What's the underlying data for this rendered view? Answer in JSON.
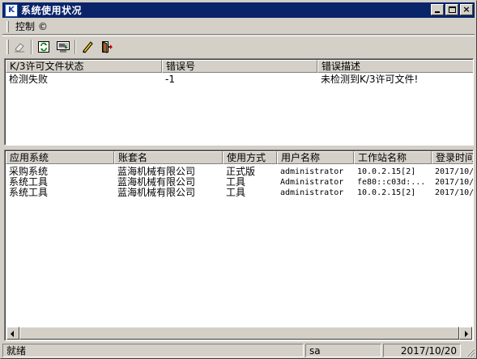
{
  "window": {
    "title": "系统使用状况",
    "icon": "k3-app-icon",
    "minimize": "minimize-icon",
    "maximize": "maximize-icon",
    "close": "×"
  },
  "menu": {
    "items": [
      "控制 ©"
    ]
  },
  "toolbar": {
    "buttons": [
      "eraser-icon",
      "refresh-icon",
      "monitor-icon",
      "edit-pencil-icon",
      "exit-door-icon"
    ]
  },
  "license_table": {
    "columns": [
      "K/3许可文件状态",
      "错误号",
      "错误描述"
    ],
    "rows": [
      [
        "检测失败",
        "-1",
        "未检测到K/3许可文件!"
      ]
    ]
  },
  "usage_table": {
    "columns": [
      "应用系统",
      "账套名",
      "使用方式",
      "用户名称",
      "工作站名称",
      "登录时间"
    ],
    "rows": [
      [
        "采购系统",
        "蓝海机械有限公司",
        "正式版",
        "administrator",
        "10.0.2.15[2]",
        "2017/10/"
      ],
      [
        "系统工具",
        "蓝海机械有限公司",
        "工具",
        "Administrator",
        "fe80::c03d:...",
        "2017/10/"
      ],
      [
        "系统工具",
        "蓝海机械有限公司",
        "工具",
        "administrator",
        "10.0.2.15[2]",
        "2017/10/"
      ]
    ]
  },
  "status": {
    "ready": "就绪",
    "user": "sa",
    "date": "2017/10/20"
  }
}
